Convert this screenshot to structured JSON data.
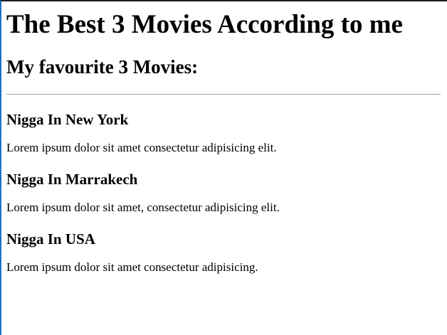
{
  "page": {
    "title": "The Best 3 Movies According to me",
    "subtitle": "My favourite 3 Movies:"
  },
  "movies": [
    {
      "title": "Nigga In New York",
      "description": "Lorem ipsum dolor sit amet consectetur adipisicing elit."
    },
    {
      "title": "Nigga In Marrakech",
      "description": "Lorem ipsum dolor sit amet, consectetur adipisicing elit."
    },
    {
      "title": "Nigga In USA",
      "description": "Lorem ipsum dolor sit amet consectetur adipisicing."
    }
  ]
}
